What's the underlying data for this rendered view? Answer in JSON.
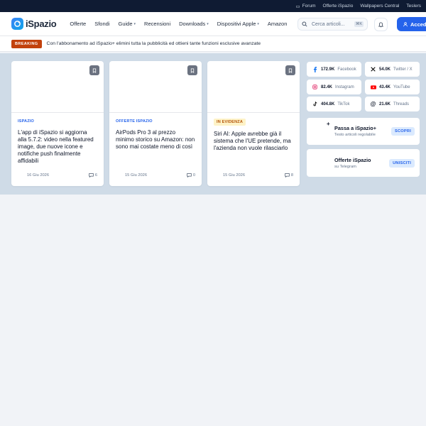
{
  "topbar": {
    "links": [
      "Forum",
      "Offerte iSpazio",
      "Wallpapers Central",
      "Teslers"
    ]
  },
  "brand": {
    "name": "iSpazio"
  },
  "nav": {
    "items": [
      {
        "label": "Offerte",
        "dropdown": false
      },
      {
        "label": "Sfondi",
        "dropdown": false
      },
      {
        "label": "Guide",
        "dropdown": true
      },
      {
        "label": "Recensioni",
        "dropdown": false
      },
      {
        "label": "Downloads",
        "dropdown": true
      },
      {
        "label": "Dispositivi Apple",
        "dropdown": true
      },
      {
        "label": "Amazon",
        "dropdown": false
      }
    ],
    "search_placeholder": "Cerca articoli...",
    "search_shortcut": "⌘K",
    "login_label": "Accedi"
  },
  "breaking": {
    "tag": "BREAKING",
    "text": "Con l'abbonamento ad iSpazio+ elimini tutta la pubblicità ed ottieni tante funzioni esclusive avanzate"
  },
  "articles": [
    {
      "category": "ISPAZIO",
      "highlight": false,
      "title": "L'app di iSpazio si aggiorna alla 5.7.2: video nella featured image, due nuove icone e notifiche push finalmente affidabili",
      "date": "16 Giu 2026",
      "comments": "6"
    },
    {
      "category": "OFFERTE ISPAZIO",
      "highlight": false,
      "title": "AirPods Pro 3 al prezzo minimo storico su Amazon: non sono mai costate meno di così",
      "date": "15 Giu 2026",
      "comments": "0"
    },
    {
      "category": "IN EVIDENZA",
      "highlight": true,
      "title": "Siri AI: Apple avrebbe già il sistema che l'UE pretende, ma l'azienda non vuole rilasciarlo",
      "date": "15 Giu 2026",
      "comments": "8"
    }
  ],
  "social": [
    {
      "icon": "facebook-icon",
      "count": "172.9K",
      "label": "Facebook",
      "color": "#1877f2"
    },
    {
      "icon": "x-icon",
      "count": "54.0K",
      "label": "Twitter / X",
      "color": "#000000"
    },
    {
      "icon": "instagram-icon",
      "count": "82.4K",
      "label": "Instagram",
      "color": "#e1306c"
    },
    {
      "icon": "youtube-icon",
      "count": "43.4K",
      "label": "YouTube",
      "color": "#ff0000"
    },
    {
      "icon": "tiktok-icon",
      "count": "404.8K",
      "label": "TikTok",
      "color": "#000000"
    },
    {
      "icon": "threads-icon",
      "count": "21.6K",
      "label": "Threads",
      "color": "#000000"
    }
  ],
  "promo_plus": {
    "title": "Passa a iSpazio+",
    "subtitle": "Testo articoli regolabile",
    "button": "SCOPRI",
    "badge": "+"
  },
  "promo_telegram": {
    "title": "Offerte iSpazio",
    "subtitle": "su Telegram",
    "button": "UNISCITI"
  },
  "colors": {
    "accent": "#2563eb",
    "breaking": "#c2410c",
    "hero_bg": "#cfdbe7",
    "topbar": "#0f1b33"
  }
}
